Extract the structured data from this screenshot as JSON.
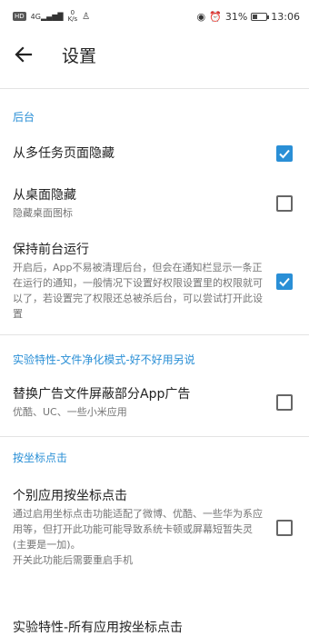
{
  "status_bar": {
    "hd": "HD",
    "signal": "4G",
    "net_speed": "0",
    "net_unit": "K/s",
    "battery": "31%",
    "battery_level": 0.31,
    "time": "13:06"
  },
  "app_bar": {
    "title": "设置"
  },
  "sections": [
    {
      "header": "后台",
      "items": [
        {
          "title": "从多任务页面隐藏",
          "subtitle": "",
          "checked": true
        },
        {
          "title": "从桌面隐藏",
          "subtitle": "隐藏桌面图标",
          "checked": false
        },
        {
          "title": "保持前台运行",
          "subtitle": "开启后，App不易被清理后台，但会在通知栏显示一条正在运行的通知，一般情况下设置好权限设置里的权限就可以了，若设置完了权限还总被杀后台，可以尝试打开此设置",
          "checked": true
        }
      ]
    },
    {
      "header": "实验特性-文件净化模式-好不好用另说",
      "items": [
        {
          "title": "替换广告文件屏蔽部分App广告",
          "subtitle": "优酷、UC、一些小米应用",
          "checked": false
        }
      ]
    },
    {
      "header": "按坐标点击",
      "items": [
        {
          "title": "个别应用按坐标点击",
          "subtitle": "通过启用坐标点击功能适配了微博、优酷、一些华为系应用等，但打开此功能可能导致系统卡顿或屏幕短暂失灵(主要是一加)。\n开关此功能后需要重启手机",
          "checked": false
        },
        {
          "title": "实验特性-所有应用按坐标点击"
        }
      ]
    }
  ]
}
